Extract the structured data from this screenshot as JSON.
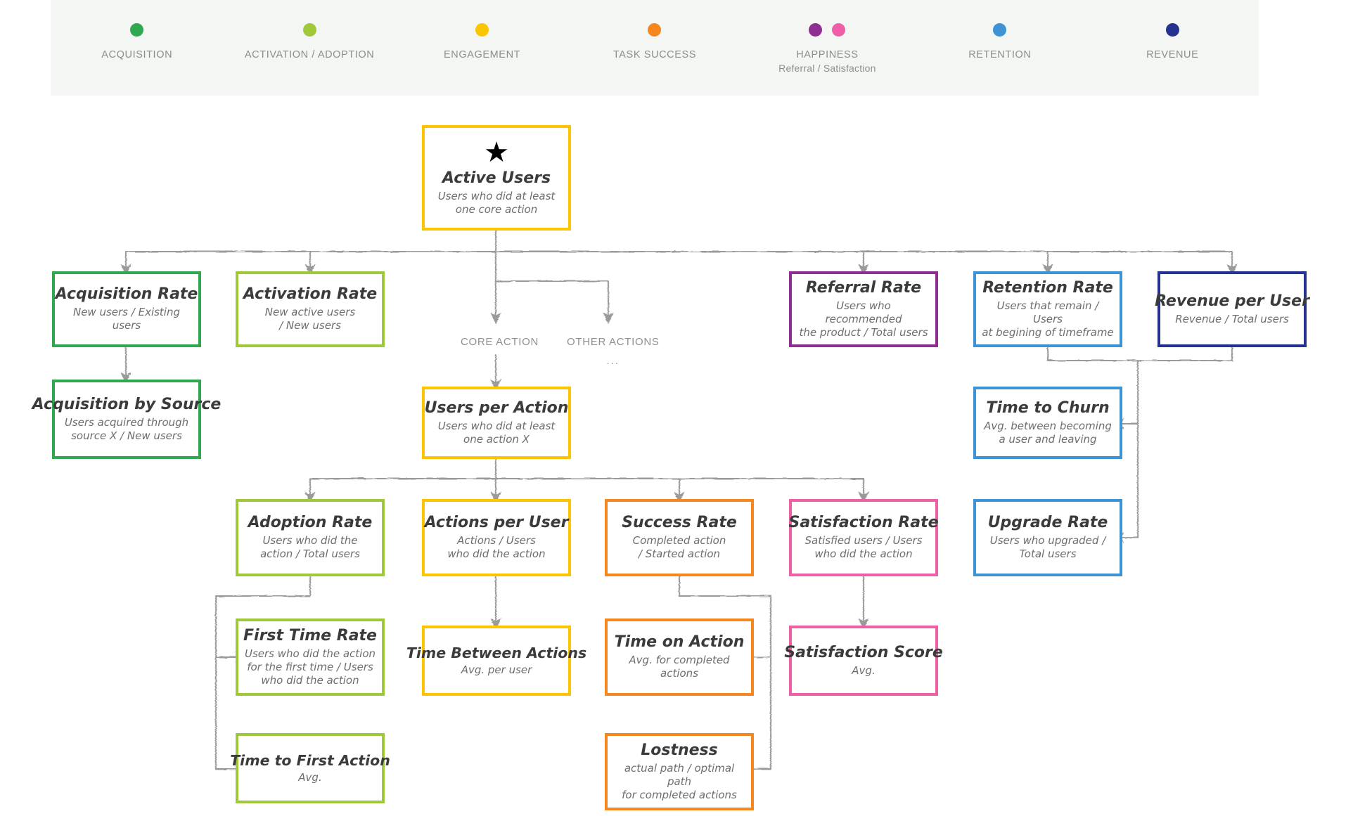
{
  "legend": {
    "items": [
      {
        "name": "legend-acquisition",
        "label": "ACQUISITION",
        "sub": "",
        "colors": [
          "#2fa84f"
        ]
      },
      {
        "name": "legend-activation-adoption",
        "label": "ACTIVATION / ADOPTION",
        "sub": "",
        "colors": [
          "#9fc83a"
        ]
      },
      {
        "name": "legend-engagement",
        "label": "ENGAGEMENT",
        "sub": "",
        "colors": [
          "#fbc500"
        ]
      },
      {
        "name": "legend-task-success",
        "label": "TASK SUCCESS",
        "sub": "",
        "colors": [
          "#f6871f"
        ]
      },
      {
        "name": "legend-happiness",
        "label": "HAPPINESS",
        "sub": "Referral / Satisfaction",
        "colors": [
          "#8e2f91",
          "#ef5fa7"
        ]
      },
      {
        "name": "legend-retention",
        "label": "RETENTION",
        "sub": "",
        "colors": [
          "#3d93d4"
        ]
      },
      {
        "name": "legend-revenue",
        "label": "REVENUE",
        "sub": "",
        "colors": [
          "#24318e"
        ]
      }
    ]
  },
  "captions": {
    "core_action": "CORE ACTION",
    "other_actions": "OTHER ACTIONS",
    "other_actions_ellipsis": "..."
  },
  "nodes": {
    "active_users": {
      "title": "Active Users",
      "desc": "Users who did at least\none core action",
      "icon": "star-icon",
      "color": "#fbc500"
    },
    "acquisition_rate": {
      "title": "Acquisition Rate",
      "desc": "New users / Existing users",
      "color": "#2fa84f"
    },
    "activation_rate": {
      "title": "Activation Rate",
      "desc": "New active users\n/ New users",
      "color": "#9fc83a"
    },
    "referral_rate": {
      "title": "Referral Rate",
      "desc": "Users who recommended\nthe product / Total users",
      "color": "#8e2f91"
    },
    "retention_rate": {
      "title": "Retention Rate",
      "desc": "Users that remain / Users\nat begining of timeframe",
      "color": "#3d93d4"
    },
    "revenue_per_user": {
      "title": "Revenue per User",
      "desc": "Revenue / Total users",
      "color": "#24318e"
    },
    "acquisition_source": {
      "title": "Acquisition by Source",
      "desc": "Users acquired through\nsource X / New users",
      "color": "#2fa84f"
    },
    "users_per_action": {
      "title": "Users per Action",
      "desc": "Users who did at least\none action X",
      "color": "#fbc500"
    },
    "time_to_churn": {
      "title": "Time to Churn",
      "desc": "Avg. between becoming\na user and leaving",
      "color": "#3d93d4"
    },
    "adoption_rate": {
      "title": "Adoption Rate",
      "desc": "Users who did the\naction / Total users",
      "color": "#9fc83a"
    },
    "actions_per_user": {
      "title": "Actions per User",
      "desc": "Actions / Users\nwho did the action",
      "color": "#fbc500"
    },
    "success_rate": {
      "title": "Success Rate",
      "desc": "Completed action\n/ Started action",
      "color": "#f6871f"
    },
    "satisfaction_rate": {
      "title": "Satisfaction Rate",
      "desc": "Satisfied users / Users\nwho did the action",
      "color": "#ef5fa7"
    },
    "upgrade_rate": {
      "title": "Upgrade Rate",
      "desc": "Users who upgraded /\nTotal users",
      "color": "#3d93d4"
    },
    "first_time_rate": {
      "title": "First Time Rate",
      "desc": "Users who did the action\nfor the first time / Users\nwho did the action",
      "color": "#9fc83a"
    },
    "time_between_actions": {
      "title": "Time Between Actions",
      "desc": "Avg. per user",
      "color": "#fbc500"
    },
    "time_on_action": {
      "title": "Time on Action",
      "desc": "Avg. for completed\nactions",
      "color": "#f6871f"
    },
    "satisfaction_score": {
      "title": "Satisfaction Score",
      "desc": "Avg.",
      "color": "#ef5fa7"
    },
    "time_to_first_action": {
      "title": "Time to First Action",
      "desc": "Avg.",
      "color": "#9fc83a"
    },
    "lostness": {
      "title": "Lostness",
      "desc": "actual path / optimal path\nfor completed actions",
      "color": "#f6871f"
    }
  },
  "icons": {
    "star": "★"
  }
}
